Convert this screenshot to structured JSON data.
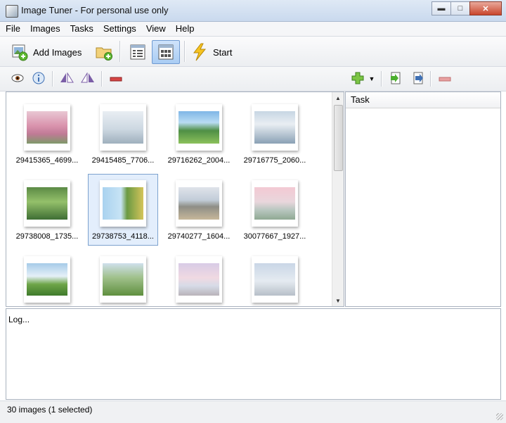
{
  "window": {
    "title": "Image Tuner - For personal use only"
  },
  "menu": [
    {
      "label": "File"
    },
    {
      "label": "Images"
    },
    {
      "label": "Tasks"
    },
    {
      "label": "Settings"
    },
    {
      "label": "View"
    },
    {
      "label": "Help"
    }
  ],
  "toolbar": {
    "add_images_label": "Add Images",
    "start_label": "Start"
  },
  "thumbnails": [
    {
      "caption": "29415365_4699...",
      "theme": "pink-blossom",
      "selected": false
    },
    {
      "caption": "29415485_7706...",
      "theme": "white-scene",
      "selected": false
    },
    {
      "caption": "29716262_2004...",
      "theme": "green-field",
      "selected": false
    },
    {
      "caption": "29716775_2060...",
      "theme": "room",
      "selected": false
    },
    {
      "caption": "29738008_1735...",
      "theme": "green-bush",
      "selected": false
    },
    {
      "caption": "29738753_4118...",
      "theme": "rotated-tree",
      "selected": true
    },
    {
      "caption": "29740277_1604...",
      "theme": "mountain",
      "selected": false
    },
    {
      "caption": "30077667_1927...",
      "theme": "pink-sky",
      "selected": false
    },
    {
      "caption": "",
      "theme": "sun-field",
      "selected": false
    },
    {
      "caption": "",
      "theme": "tree-bench",
      "selected": false
    },
    {
      "caption": "",
      "theme": "pastel-sky",
      "selected": false
    },
    {
      "caption": "",
      "theme": "horse",
      "selected": false
    }
  ],
  "task_panel": {
    "header": "Task"
  },
  "log": {
    "text": "Log..."
  },
  "status": {
    "text": "30 images (1 selected)"
  },
  "colors": {
    "selection": "#e3eefc",
    "selection_border": "#7da2ce",
    "accent_green": "#5cb82f"
  }
}
